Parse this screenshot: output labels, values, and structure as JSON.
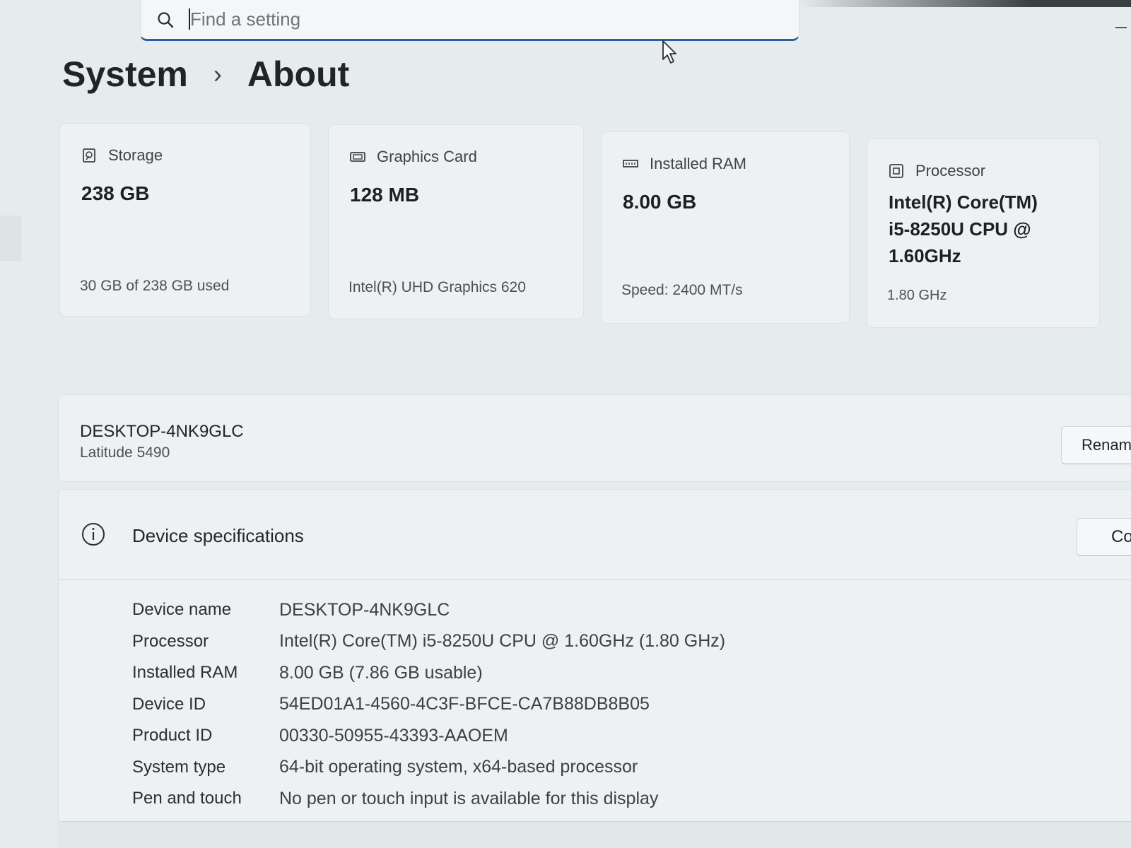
{
  "search": {
    "placeholder": "Find a setting"
  },
  "breadcrumb": {
    "parent": "System",
    "separator": "›",
    "current": "About"
  },
  "cards": [
    {
      "label": "Storage",
      "value": "238 GB",
      "sub": "30 GB of 238 GB used",
      "icon": "storage-icon"
    },
    {
      "label": "Graphics Card",
      "value": "128 MB",
      "sub": "Intel(R) UHD Graphics 620",
      "icon": "graphics-card-icon"
    },
    {
      "label": "Installed RAM",
      "value": "8.00 GB",
      "sub": "Speed: 2400 MT/s",
      "icon": "ram-icon"
    },
    {
      "label": "Processor",
      "value_lines": [
        "Intel(R) Core(TM)",
        "i5-8250U CPU @",
        "1.60GHz"
      ],
      "sub": "1.80 GHz",
      "icon": "processor-icon"
    }
  ],
  "device": {
    "name": "DESKTOP-4NK9GLC",
    "model": "Latitude 5490",
    "rename_label": "Rename"
  },
  "specs": {
    "title": "Device specifications",
    "copy_label": "Copy",
    "rows": [
      {
        "label": "Device name",
        "value": "DESKTOP-4NK9GLC"
      },
      {
        "label": "Processor",
        "value": "Intel(R) Core(TM) i5-8250U CPU @ 1.60GHz (1.80 GHz)"
      },
      {
        "label": "Installed RAM",
        "value": "8.00 GB (7.86 GB usable)"
      },
      {
        "label": "Device ID",
        "value": "54ED01A1-4560-4C3F-BFCE-CA7B88DB8B05"
      },
      {
        "label": "Product ID",
        "value": "00330-50955-43393-AAOEM"
      },
      {
        "label": "System type",
        "value": "64-bit operating system, x64-based processor"
      },
      {
        "label": "Pen and touch",
        "value": "No pen or touch input is available for this display"
      }
    ]
  },
  "colors": {
    "accent": "#2b5e9e",
    "background": "#e6ebee",
    "card": "#eef1f3"
  }
}
